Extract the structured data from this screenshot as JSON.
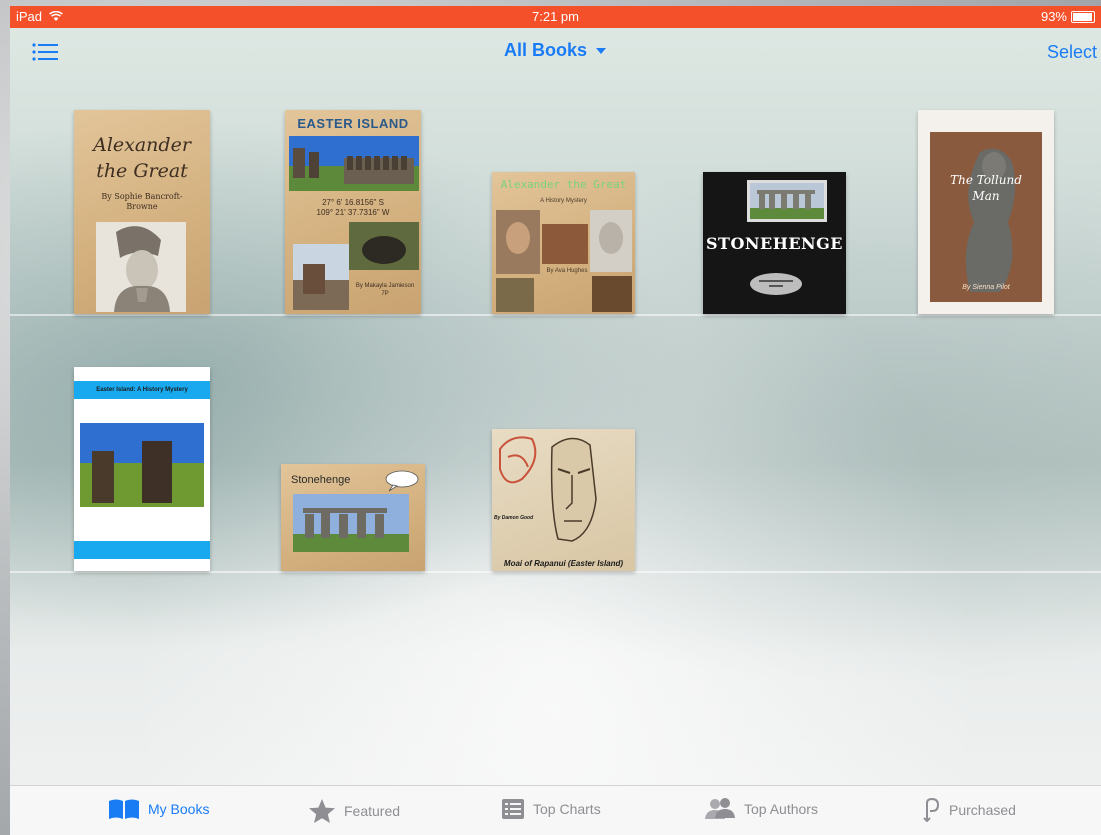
{
  "status": {
    "carrier": "iPad",
    "time": "7:21 pm",
    "battery": "93%",
    "battery_level": 0.93
  },
  "nav": {
    "title": "All Books",
    "select_label": "Select"
  },
  "books": {
    "b1": {
      "title_line1": "Alexander",
      "title_line2": "the Great",
      "author": "By Sophie Bancroft-Browne"
    },
    "b2": {
      "title": "EASTER ISLAND",
      "coords1": "27° 6' 16.8156\" S",
      "coords2": "109° 21' 37.7316\" W",
      "author": "By Makayla Jamieson 7P"
    },
    "b3": {
      "title": "Alexander the Great",
      "subtitle": "A History Mystery",
      "author": "By Ava Hughes"
    },
    "b4": {
      "title": "STONEHENGE"
    },
    "b5": {
      "title_line1": "The Tollund",
      "title_line2": "Man",
      "author": "By Sienna Pilot"
    },
    "b6": {
      "title": "Easter Island: A History Mystery"
    },
    "b7": {
      "title": "Stonehenge"
    },
    "b8": {
      "author": "By Damon Good",
      "title": "Moai of Rapanui (Easter Island)"
    }
  },
  "tabs": [
    {
      "label": "My Books",
      "icon": "open-book-icon",
      "active": true
    },
    {
      "label": "Featured",
      "icon": "star-icon",
      "active": false
    },
    {
      "label": "Top Charts",
      "icon": "list-icon",
      "active": false
    },
    {
      "label": "Top Authors",
      "icon": "people-icon",
      "active": false
    },
    {
      "label": "Purchased",
      "icon": "purchased-icon",
      "active": false
    }
  ],
  "colors": {
    "accent": "#1a7cf5",
    "status_bar": "#f4512b",
    "inactive": "#8e8e93"
  }
}
